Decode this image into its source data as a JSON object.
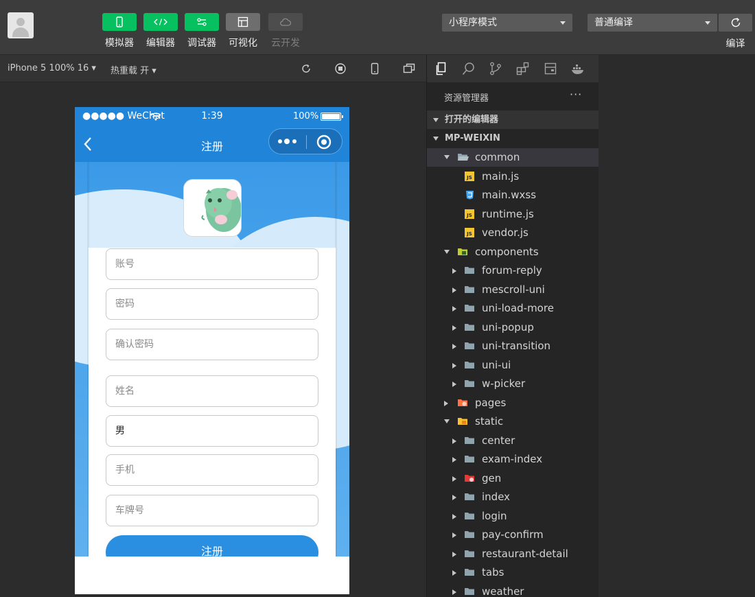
{
  "toolbar": {
    "buttons": [
      {
        "label": "模拟器",
        "icon": "phone-icon"
      },
      {
        "label": "编辑器",
        "icon": "code-icon"
      },
      {
        "label": "调试器",
        "icon": "debug-icon"
      },
      {
        "label": "可视化",
        "icon": "layout-icon"
      },
      {
        "label": "云开发",
        "icon": "cloud-icon"
      }
    ],
    "mode_select": "小程序模式",
    "compile_select": "普通编译",
    "compile_label": "编译"
  },
  "simulator_bar": {
    "device": "iPhone 5 100% 16 ▾",
    "hot_reload": "热重载 开 ▾"
  },
  "phone": {
    "carrier": "●●●●● WeChat",
    "time": "1:39",
    "battery": "100%",
    "nav_title": "注册",
    "fields": [
      {
        "placeholder": "账号",
        "value": ""
      },
      {
        "placeholder": "密码",
        "value": ""
      },
      {
        "placeholder": "确认密码",
        "value": ""
      },
      {
        "placeholder": "姓名",
        "value": ""
      },
      {
        "placeholder": "",
        "value": "男"
      },
      {
        "placeholder": "手机",
        "value": ""
      },
      {
        "placeholder": "车牌号",
        "value": ""
      }
    ],
    "register_button": "注册"
  },
  "explorer": {
    "title": "资源管理器",
    "more": "···",
    "open_editors": "打开的编辑器",
    "project": "MP-WEIXIN",
    "tree": [
      {
        "name": "common",
        "type": "folder-open",
        "level": 1,
        "state": "open",
        "selected": true
      },
      {
        "name": "main.js",
        "type": "js",
        "level": 2
      },
      {
        "name": "main.wxss",
        "type": "css",
        "level": 2
      },
      {
        "name": "runtime.js",
        "type": "js",
        "level": 2
      },
      {
        "name": "vendor.js",
        "type": "js",
        "level": 2
      },
      {
        "name": "components",
        "type": "folder-special",
        "level": 1,
        "state": "open"
      },
      {
        "name": "forum-reply",
        "type": "folder",
        "level": 2,
        "state": "closed"
      },
      {
        "name": "mescroll-uni",
        "type": "folder",
        "level": 2,
        "state": "closed"
      },
      {
        "name": "uni-load-more",
        "type": "folder",
        "level": 2,
        "state": "closed"
      },
      {
        "name": "uni-popup",
        "type": "folder",
        "level": 2,
        "state": "closed"
      },
      {
        "name": "uni-transition",
        "type": "folder",
        "level": 2,
        "state": "closed"
      },
      {
        "name": "uni-ui",
        "type": "folder",
        "level": 2,
        "state": "closed"
      },
      {
        "name": "w-picker",
        "type": "folder",
        "level": 2,
        "state": "closed"
      },
      {
        "name": "pages",
        "type": "folder-pages",
        "level": 1,
        "state": "closed"
      },
      {
        "name": "static",
        "type": "folder-static",
        "level": 1,
        "state": "open"
      },
      {
        "name": "center",
        "type": "folder",
        "level": 2,
        "state": "closed"
      },
      {
        "name": "exam-index",
        "type": "folder",
        "level": 2,
        "state": "closed"
      },
      {
        "name": "gen",
        "type": "folder-gen",
        "level": 2,
        "state": "closed"
      },
      {
        "name": "index",
        "type": "folder",
        "level": 2,
        "state": "closed"
      },
      {
        "name": "login",
        "type": "folder",
        "level": 2,
        "state": "closed"
      },
      {
        "name": "pay-confirm",
        "type": "folder",
        "level": 2,
        "state": "closed"
      },
      {
        "name": "restaurant-detail",
        "type": "folder",
        "level": 2,
        "state": "closed"
      },
      {
        "name": "tabs",
        "type": "folder",
        "level": 2,
        "state": "closed"
      },
      {
        "name": "weather",
        "type": "folder",
        "level": 2,
        "state": "closed"
      }
    ]
  },
  "colors": {
    "green": "#07c160",
    "phone_blue": "#2084d8",
    "js_yellow": "#f2c531",
    "css_blue": "#42a5f5",
    "folder_gray": "#90a4ae"
  }
}
